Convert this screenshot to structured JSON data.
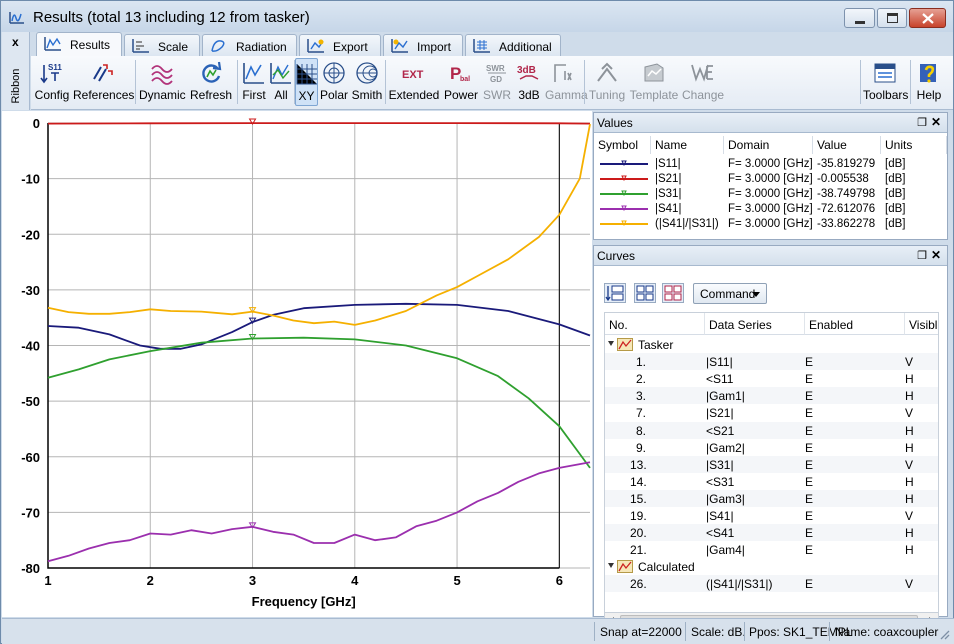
{
  "window": {
    "title": "Results (total 13 including 12 from tasker)"
  },
  "ribbon": {
    "close_glyph": "x",
    "label": "Ribbon"
  },
  "tabs": [
    {
      "label": "Results",
      "icon": "results-tab-icon",
      "active": true
    },
    {
      "label": "Scale",
      "icon": "scale-tab-icon",
      "active": false
    },
    {
      "label": "Radiation",
      "icon": "radiation-tab-icon",
      "active": false
    },
    {
      "label": "Export",
      "icon": "export-tab-icon",
      "active": false
    },
    {
      "label": "Import",
      "icon": "import-tab-icon",
      "active": false
    },
    {
      "label": "Additional",
      "icon": "additional-tab-icon",
      "active": false
    }
  ],
  "toolbar": {
    "config": "Config",
    "references": "References",
    "dynamic": "Dynamic",
    "refresh": "Refresh",
    "first": "First",
    "all": "All",
    "xy": "XY",
    "polar": "Polar",
    "smith": "Smith",
    "extended": "Extended",
    "power": "Power",
    "swr": "SWR",
    "db3": "3dB",
    "gamma": "Gamma",
    "tuning": "Tuning",
    "template": "Template",
    "change": "Change",
    "toolbars": "Toolbars",
    "help": "Help",
    "icon_text": {
      "config": "S11",
      "extended": "EXT",
      "power": "P",
      "power_sub": "bal",
      "swr": "SWR",
      "swr_sub": "GD",
      "db3": "3dB"
    }
  },
  "values_panel": {
    "title": "Values",
    "columns": [
      "Symbol",
      "Name",
      "Domain",
      "Value",
      "Units"
    ],
    "rows": [
      {
        "name": "|S11|",
        "domain": "F=  3.0000 [GHz]",
        "value": "-35.819279",
        "units": "[dB]",
        "color": "#1a1a7a"
      },
      {
        "name": "|S21|",
        "domain": "F=  3.0000 [GHz]",
        "value": "-0.005538",
        "units": "[dB]",
        "color": "#cc1a1a"
      },
      {
        "name": "|S31|",
        "domain": "F=  3.0000 [GHz]",
        "value": "-38.749798",
        "units": "[dB]",
        "color": "#2fa02f"
      },
      {
        "name": "|S41|",
        "domain": "F=  3.0000 [GHz]",
        "value": "-72.612076",
        "units": "[dB]",
        "color": "#9b2fae"
      },
      {
        "name": "(|S41|/|S31|)",
        "domain": "F=  3.0000 [GHz]",
        "value": "-33.862278",
        "units": "[dB]",
        "color": "#f5b000"
      }
    ]
  },
  "curves_panel": {
    "title": "Curves",
    "command_label": "Command",
    "columns": [
      "No.",
      "Data Series",
      "Enabled",
      "Visible"
    ],
    "groups": [
      {
        "name": "Tasker",
        "rows": [
          {
            "no": "1.",
            "series": "|S11|",
            "enabled": "E",
            "visible": "V"
          },
          {
            "no": "2.",
            "series": "<S11",
            "enabled": "E",
            "visible": "H"
          },
          {
            "no": "3.",
            "series": "|Gam1|",
            "enabled": "E",
            "visible": "H"
          },
          {
            "no": "7.",
            "series": "|S21|",
            "enabled": "E",
            "visible": "V"
          },
          {
            "no": "8.",
            "series": "<S21",
            "enabled": "E",
            "visible": "H"
          },
          {
            "no": "9.",
            "series": "|Gam2|",
            "enabled": "E",
            "visible": "H"
          },
          {
            "no": "13.",
            "series": "|S31|",
            "enabled": "E",
            "visible": "V"
          },
          {
            "no": "14.",
            "series": "<S31",
            "enabled": "E",
            "visible": "H"
          },
          {
            "no": "15.",
            "series": "|Gam3|",
            "enabled": "E",
            "visible": "H"
          },
          {
            "no": "19.",
            "series": "|S41|",
            "enabled": "E",
            "visible": "V"
          },
          {
            "no": "20.",
            "series": "<S41",
            "enabled": "E",
            "visible": "H"
          },
          {
            "no": "21.",
            "series": "|Gam4|",
            "enabled": "E",
            "visible": "H"
          }
        ]
      },
      {
        "name": "Calculated",
        "rows": [
          {
            "no": "26.",
            "series": "(|S41|/|S31|)",
            "enabled": "E",
            "visible": "V"
          }
        ]
      }
    ]
  },
  "status": {
    "snap": "Snap at=22000",
    "scale": "Scale: dB.",
    "ppos": "Ppos: SK1_TEMPL",
    "name": "Name: coaxcoupler"
  },
  "chart_data": {
    "type": "line",
    "xlabel": "Frequency [GHz]",
    "xlim": [
      1,
      6.3
    ],
    "ylim": [
      -80,
      0
    ],
    "x_ticks": [
      1,
      2,
      3,
      4,
      5,
      6
    ],
    "y_ticks": [
      0,
      -10,
      -20,
      -30,
      -40,
      -50,
      -60,
      -70,
      -80
    ],
    "grid": true,
    "marker_x": 3,
    "series": [
      {
        "name": "|S21|",
        "color": "#cc1a1a",
        "x": [
          1,
          2,
          3,
          4,
          5,
          6,
          6.3
        ],
        "y": [
          -0.1,
          -0.05,
          -0.01,
          -0.01,
          -0.02,
          -0.05,
          -0.1
        ]
      },
      {
        "name": "|S11|",
        "color": "#1a1a7a",
        "x": [
          1,
          1.3,
          1.6,
          1.9,
          2.1,
          2.3,
          2.5,
          2.8,
          3.0,
          3.2,
          3.5,
          4.0,
          4.5,
          5.0,
          5.5,
          6.0,
          6.3
        ],
        "y": [
          -36.5,
          -36.8,
          -38.0,
          -40.0,
          -40.6,
          -40.6,
          -39.8,
          -37.6,
          -35.8,
          -34.5,
          -33.3,
          -32.7,
          -32.5,
          -32.7,
          -33.8,
          -36.2,
          -38.2
        ]
      },
      {
        "name": "|S31|",
        "color": "#2fa02f",
        "x": [
          1,
          1.3,
          1.6,
          2.0,
          2.5,
          3.0,
          3.5,
          4.0,
          4.5,
          5.0,
          5.4,
          5.7,
          6.0,
          6.2,
          6.3
        ],
        "y": [
          -45.8,
          -44.3,
          -42.5,
          -41.0,
          -39.5,
          -38.75,
          -38.6,
          -38.9,
          -40.0,
          -42.3,
          -45.5,
          -49.5,
          -54.5,
          -59.5,
          -62.0
        ]
      },
      {
        "name": "|S41|",
        "color": "#9b2fae",
        "x": [
          1,
          1.2,
          1.4,
          1.6,
          1.8,
          2.0,
          2.2,
          2.4,
          2.6,
          2.8,
          3.0,
          3.2,
          3.4,
          3.6,
          3.8,
          4.0,
          4.2,
          4.4,
          4.6,
          4.8,
          5.0,
          5.2,
          5.4,
          5.6,
          5.8,
          6.0,
          6.3
        ],
        "y": [
          -78.8,
          -77.8,
          -76.5,
          -75.5,
          -75.0,
          -73.8,
          -74.0,
          -73.2,
          -73.8,
          -73.0,
          -72.6,
          -73.5,
          -74.0,
          -75.5,
          -75.5,
          -74.0,
          -75.0,
          -74.5,
          -72.5,
          -71.5,
          -70.0,
          -68.0,
          -66.5,
          -64.5,
          -63.0,
          -62.0,
          -61.0
        ]
      },
      {
        "name": "(|S41|/|S31|)",
        "color": "#f5b000",
        "x": [
          1,
          1.2,
          1.4,
          1.6,
          1.8,
          2.0,
          2.2,
          2.5,
          2.8,
          3.0,
          3.2,
          3.4,
          3.6,
          3.8,
          4.0,
          4.2,
          4.5,
          4.8,
          5.0,
          5.2,
          5.5,
          5.8,
          6.0,
          6.2,
          6.3
        ],
        "y": [
          -33.2,
          -34.0,
          -34.3,
          -34.3,
          -34.0,
          -33.5,
          -33.8,
          -33.9,
          -34.4,
          -33.9,
          -34.6,
          -35.5,
          -36.0,
          -35.7,
          -36.3,
          -35.5,
          -33.8,
          -31.0,
          -29.5,
          -27.5,
          -24.5,
          -20.5,
          -16.5,
          -10.0,
          -0.2
        ]
      }
    ]
  }
}
